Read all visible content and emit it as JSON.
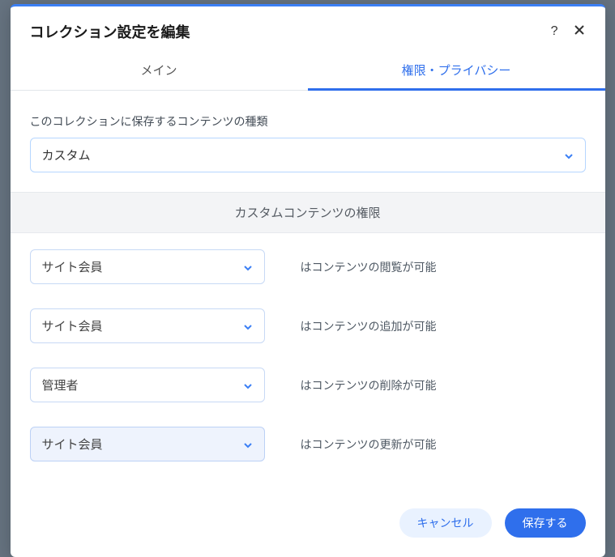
{
  "modal": {
    "title": "コレクション設定を編集"
  },
  "tabs": {
    "main": "メイン",
    "privacy": "権限・プライバシー"
  },
  "contentType": {
    "label": "このコレクションに保存するコンテンツの種類",
    "value": "カスタム"
  },
  "sectionTitle": "カスタムコンテンツの権限",
  "permissions": {
    "view": {
      "role": "サイト会員",
      "label": "はコンテンツの閲覧が可能"
    },
    "add": {
      "role": "サイト会員",
      "label": "はコンテンツの追加が可能"
    },
    "delete": {
      "role": "管理者",
      "label": "はコンテンツの削除が可能"
    },
    "update": {
      "role": "サイト会員",
      "label": "はコンテンツの更新が可能"
    }
  },
  "footer": {
    "cancel": "キャンセル",
    "save": "保存する"
  }
}
